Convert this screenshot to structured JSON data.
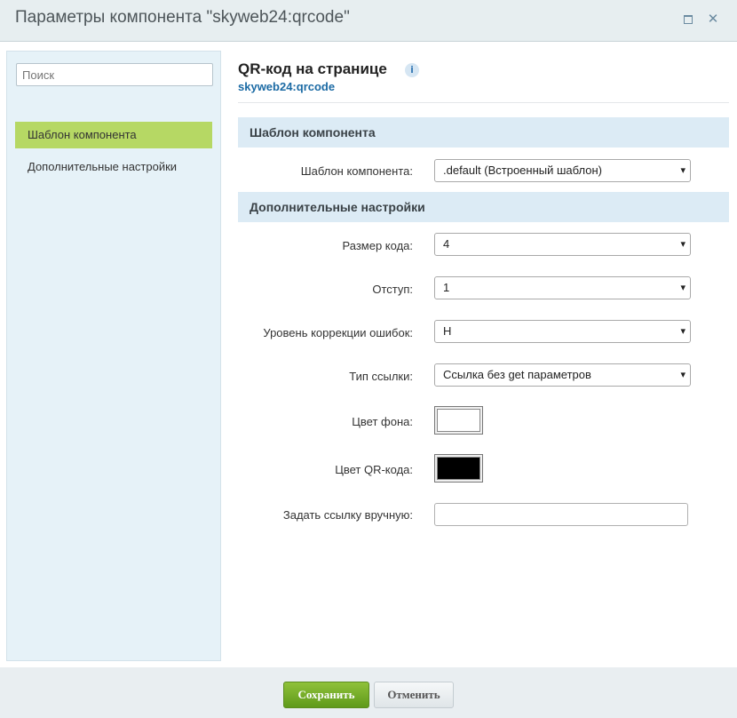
{
  "window": {
    "title": "Параметры компонента \"skyweb24:qrcode\"",
    "maximize_icon": "maximize-icon",
    "close_icon": "close-icon"
  },
  "sidebar": {
    "search_placeholder": "Поиск",
    "items": [
      {
        "label": "Шаблон компонента",
        "active": true
      },
      {
        "label": "Дополнительные настройки",
        "active": false
      }
    ]
  },
  "content": {
    "title": "QR-код на странице",
    "info_icon": "info-icon",
    "subtitle": "skyweb24:qrcode",
    "sections": [
      {
        "title": "Шаблон компонента"
      },
      {
        "title": "Дополнительные настройки"
      }
    ],
    "fields": {
      "template": {
        "label": "Шаблон компонента:",
        "value": ".default (Встроенный шаблон)"
      },
      "code_size": {
        "label": "Размер кода:",
        "value": "4"
      },
      "margin": {
        "label": "Отступ:",
        "value": "1"
      },
      "error_level": {
        "label": "Уровень коррекции ошибок:",
        "value": "H"
      },
      "link_type": {
        "label": "Тип ссылки:",
        "value": "Ссылка без get параметров"
      },
      "bg_color": {
        "label": "Цвет фона:",
        "value": "#ffffff"
      },
      "qr_color": {
        "label": "Цвет QR-кода:",
        "value": "#000000"
      },
      "manual_link": {
        "label": "Задать ссылку вручную:",
        "value": ""
      }
    }
  },
  "footer": {
    "save_label": "Сохранить",
    "cancel_label": "Отменить"
  },
  "colors": {
    "accent_green": "#7fb22e",
    "section_bg": "#dcebf5",
    "sidebar_bg": "#e6f2f8",
    "link_blue": "#1b6aa4"
  }
}
